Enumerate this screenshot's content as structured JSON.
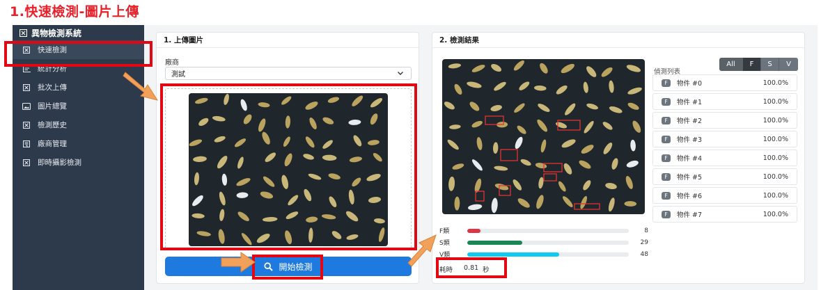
{
  "slide": {
    "title": "1.快速檢測-圖片上傳"
  },
  "sidebar": {
    "brand": "異物檢測系統",
    "items": [
      {
        "label": "快速檢測",
        "icon": "checkbox-x-icon",
        "active": true
      },
      {
        "label": "統計分析",
        "icon": "chart-icon"
      },
      {
        "label": "批次上傳",
        "icon": "checkbox-x-icon"
      },
      {
        "label": "圖片總覽",
        "icon": "image-icon"
      },
      {
        "label": "檢測歷史",
        "icon": "checkbox-x-icon"
      },
      {
        "label": "廠商管理",
        "icon": "building-icon"
      },
      {
        "label": "即時攝影檢測",
        "icon": "checkbox-x-icon"
      }
    ]
  },
  "upload": {
    "header": "1. 上傳圖片",
    "vendor_label": "廠商",
    "vendor_value": "測試",
    "start_button": "開始檢測"
  },
  "result": {
    "header": "2. 檢測結果",
    "list_title": "偵測列表",
    "filters": [
      "All",
      "F",
      "S",
      "V"
    ],
    "stats": [
      {
        "label": "F類",
        "count": "8",
        "fraction": 0.08,
        "color": "#dc3545"
      },
      {
        "label": "S類",
        "count": "29",
        "fraction": 0.34,
        "color": "#198754"
      },
      {
        "label": "V類",
        "count": "48",
        "fraction": 0.57,
        "color": "#0dcaf0"
      }
    ],
    "elapsed_label": "耗時",
    "elapsed_value": "0.81",
    "elapsed_unit": "秒",
    "detections": [
      {
        "badge": "F",
        "name": "物件 #0",
        "conf": "100.0%"
      },
      {
        "badge": "F",
        "name": "物件 #1",
        "conf": "100.0%"
      },
      {
        "badge": "F",
        "name": "物件 #2",
        "conf": "100.0%"
      },
      {
        "badge": "F",
        "name": "物件 #3",
        "conf": "100.0%"
      },
      {
        "badge": "F",
        "name": "物件 #4",
        "conf": "100.0%"
      },
      {
        "badge": "F",
        "name": "物件 #5",
        "conf": "100.0%"
      },
      {
        "badge": "F",
        "name": "物件 #6",
        "conf": "100.0%"
      },
      {
        "badge": "F",
        "name": "物件 #7",
        "conf": "100.0%"
      }
    ]
  },
  "colors": {
    "sidebar": "#2d3a4b",
    "primary": "#1f7ae0",
    "highlight": "#e30613",
    "arrow": "#f2a15b"
  }
}
